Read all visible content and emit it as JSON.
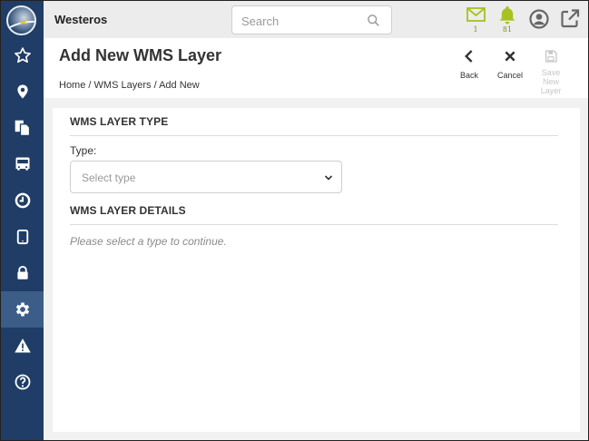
{
  "app": {
    "name": "Westeros"
  },
  "search": {
    "placeholder": "Search"
  },
  "header": {
    "messages_count": "1",
    "alerts_count": "81",
    "colors": {
      "accent": "#a8c020",
      "sidebar": "#1f3d66",
      "sidebar_active": "#3b5d87"
    }
  },
  "sidebar": {
    "items": [
      {
        "icon": "star-icon"
      },
      {
        "icon": "map-pin-icon"
      },
      {
        "icon": "documents-icon"
      },
      {
        "icon": "bus-icon"
      },
      {
        "icon": "clock-icon"
      },
      {
        "icon": "tablet-icon"
      },
      {
        "icon": "lock-icon"
      },
      {
        "icon": "gear-icon",
        "active": true
      },
      {
        "icon": "warning-icon"
      },
      {
        "icon": "help-icon"
      }
    ]
  },
  "page": {
    "title": "Add New WMS Layer",
    "breadcrumb": {
      "home": "Home",
      "sep1": "/",
      "parent": "WMS Layers",
      "sep2": "/",
      "current": "Add New"
    },
    "actions": {
      "back": "Back",
      "cancel": "Cancel",
      "save_line1": "Save New",
      "save_line2": "Layer"
    }
  },
  "form": {
    "type_section": "WMS LAYER TYPE",
    "type_label": "Type:",
    "type_placeholder": "Select type",
    "details_section": "WMS LAYER DETAILS",
    "details_hint": "Please select a type to continue."
  }
}
